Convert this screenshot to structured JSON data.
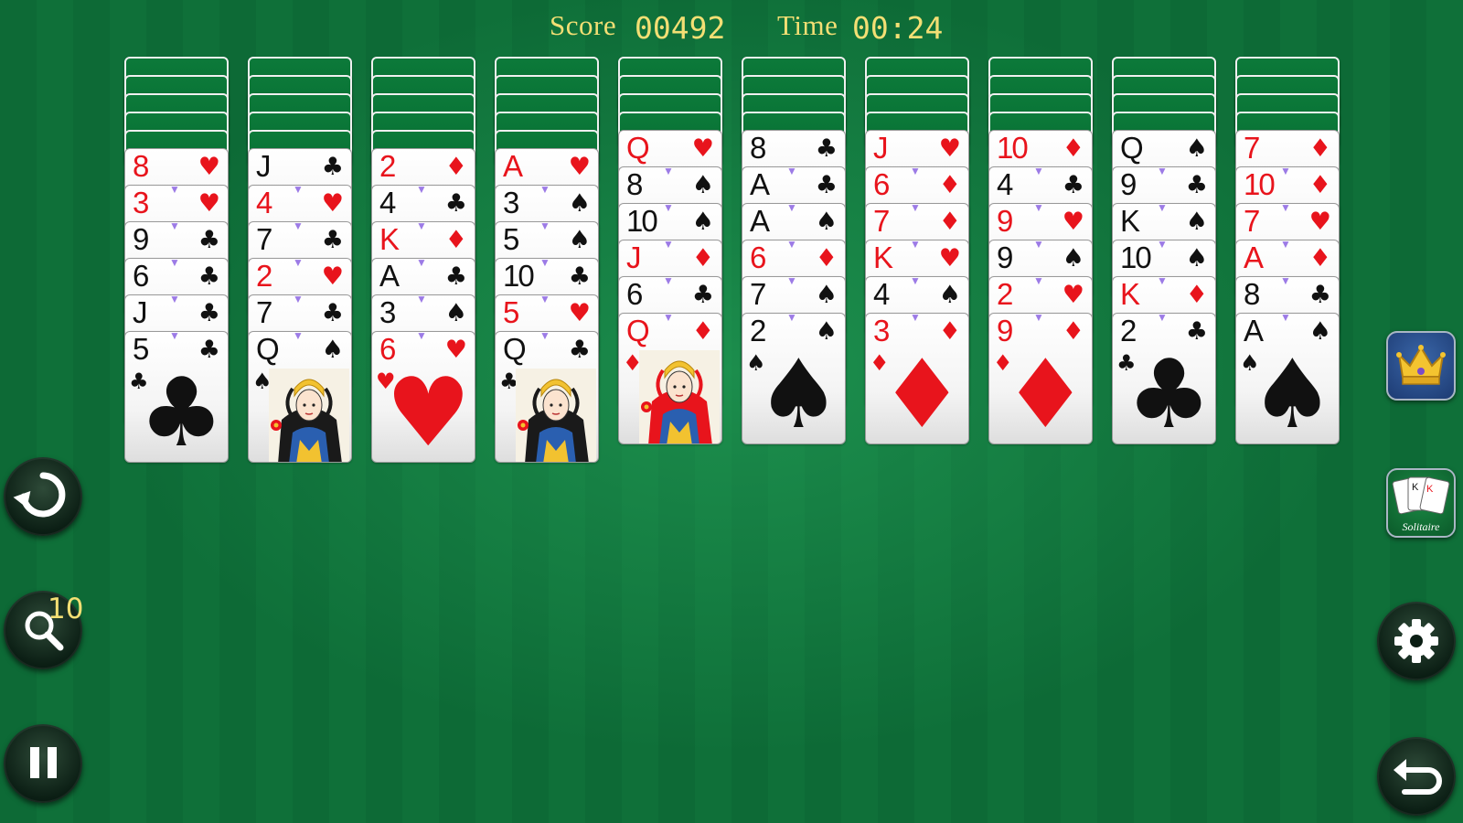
{
  "header": {
    "score_label": "Score",
    "score_value": "00492",
    "time_label": "Time",
    "time_value": "00:24"
  },
  "tableau": [
    {
      "face_down": 5,
      "cards": [
        {
          "rank": "8",
          "suit": "hearts"
        },
        {
          "rank": "3",
          "suit": "hearts"
        },
        {
          "rank": "9",
          "suit": "clubs"
        },
        {
          "rank": "6",
          "suit": "clubs"
        },
        {
          "rank": "J",
          "suit": "clubs"
        },
        {
          "rank": "5",
          "suit": "clubs"
        }
      ]
    },
    {
      "face_down": 5,
      "cards": [
        {
          "rank": "J",
          "suit": "clubs"
        },
        {
          "rank": "4",
          "suit": "hearts"
        },
        {
          "rank": "7",
          "suit": "clubs"
        },
        {
          "rank": "2",
          "suit": "hearts"
        },
        {
          "rank": "7",
          "suit": "clubs"
        },
        {
          "rank": "Q",
          "suit": "spades"
        }
      ]
    },
    {
      "face_down": 5,
      "cards": [
        {
          "rank": "2",
          "suit": "diamonds"
        },
        {
          "rank": "4",
          "suit": "clubs"
        },
        {
          "rank": "K",
          "suit": "diamonds"
        },
        {
          "rank": "A",
          "suit": "clubs"
        },
        {
          "rank": "3",
          "suit": "spades"
        },
        {
          "rank": "6",
          "suit": "hearts"
        }
      ]
    },
    {
      "face_down": 5,
      "cards": [
        {
          "rank": "A",
          "suit": "hearts"
        },
        {
          "rank": "3",
          "suit": "spades"
        },
        {
          "rank": "5",
          "suit": "spades"
        },
        {
          "rank": "10",
          "suit": "clubs"
        },
        {
          "rank": "5",
          "suit": "hearts"
        },
        {
          "rank": "Q",
          "suit": "clubs"
        }
      ]
    },
    {
      "face_down": 4,
      "cards": [
        {
          "rank": "Q",
          "suit": "hearts"
        },
        {
          "rank": "8",
          "suit": "spades"
        },
        {
          "rank": "10",
          "suit": "spades"
        },
        {
          "rank": "J",
          "suit": "diamonds"
        },
        {
          "rank": "6",
          "suit": "clubs"
        },
        {
          "rank": "Q",
          "suit": "diamonds"
        }
      ]
    },
    {
      "face_down": 4,
      "cards": [
        {
          "rank": "8",
          "suit": "clubs"
        },
        {
          "rank": "A",
          "suit": "clubs"
        },
        {
          "rank": "A",
          "suit": "spades"
        },
        {
          "rank": "6",
          "suit": "diamonds"
        },
        {
          "rank": "7",
          "suit": "spades"
        },
        {
          "rank": "2",
          "suit": "spades"
        }
      ]
    },
    {
      "face_down": 4,
      "cards": [
        {
          "rank": "J",
          "suit": "hearts"
        },
        {
          "rank": "6",
          "suit": "diamonds"
        },
        {
          "rank": "7",
          "suit": "diamonds"
        },
        {
          "rank": "K",
          "suit": "hearts"
        },
        {
          "rank": "4",
          "suit": "spades"
        },
        {
          "rank": "3",
          "suit": "diamonds"
        }
      ]
    },
    {
      "face_down": 4,
      "cards": [
        {
          "rank": "10",
          "suit": "diamonds"
        },
        {
          "rank": "4",
          "suit": "clubs"
        },
        {
          "rank": "9",
          "suit": "hearts"
        },
        {
          "rank": "9",
          "suit": "spades"
        },
        {
          "rank": "2",
          "suit": "hearts"
        },
        {
          "rank": "9",
          "suit": "diamonds"
        }
      ]
    },
    {
      "face_down": 4,
      "cards": [
        {
          "rank": "Q",
          "suit": "spades"
        },
        {
          "rank": "9",
          "suit": "clubs"
        },
        {
          "rank": "K",
          "suit": "spades"
        },
        {
          "rank": "10",
          "suit": "spades"
        },
        {
          "rank": "K",
          "suit": "diamonds"
        },
        {
          "rank": "2",
          "suit": "clubs"
        }
      ]
    },
    {
      "face_down": 4,
      "cards": [
        {
          "rank": "7",
          "suit": "diamonds"
        },
        {
          "rank": "10",
          "suit": "diamonds"
        },
        {
          "rank": "7",
          "suit": "hearts"
        },
        {
          "rank": "A",
          "suit": "diamonds"
        },
        {
          "rank": "8",
          "suit": "clubs"
        },
        {
          "rank": "A",
          "suit": "spades"
        }
      ]
    }
  ],
  "hint_count": "10",
  "solitaire_button_label": "Solitaire",
  "icons": {
    "restart": "restart-icon",
    "hint": "magnifier-icon",
    "pause": "pause-icon",
    "crown": "crown-icon",
    "solitaire": "cards-icon",
    "settings": "gear-icon",
    "undo": "undo-icon"
  },
  "colors": {
    "felt": "#0d6a36",
    "header_text": "#f3df74",
    "red_suit": "#e8141c",
    "black_suit": "#111111"
  }
}
